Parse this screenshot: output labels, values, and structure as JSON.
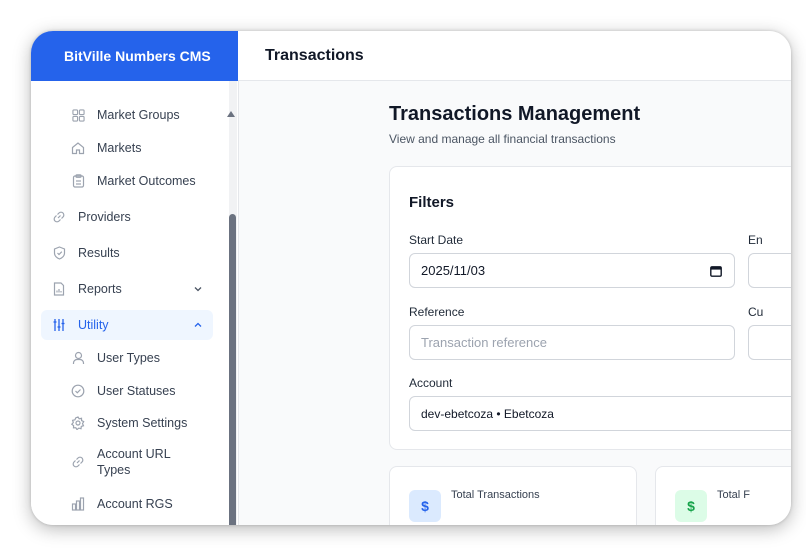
{
  "app": {
    "brand": "BitVille Numbers CMS",
    "header_title": "Transactions"
  },
  "sidebar": {
    "items": [
      {
        "label": "Market Groups"
      },
      {
        "label": "Markets"
      },
      {
        "label": "Market Outcomes"
      },
      {
        "label": "Providers"
      },
      {
        "label": "Results"
      },
      {
        "label": "Reports"
      },
      {
        "label": "Utility"
      },
      {
        "label": "User Types"
      },
      {
        "label": "User Statuses"
      },
      {
        "label": "System Settings"
      },
      {
        "label": "Account URL Types"
      },
      {
        "label": "Account RGS"
      }
    ],
    "accent_color": "#2563eb"
  },
  "page": {
    "title": "Transactions Management",
    "subtitle": "View and manage all financial transactions"
  },
  "filters": {
    "title": "Filters",
    "start_date": {
      "label": "Start Date",
      "value": "2025/11/03"
    },
    "end_date": {
      "label": "En"
    },
    "reference": {
      "label": "Reference",
      "placeholder": "Transaction reference"
    },
    "second_col_label": "Cu",
    "account": {
      "label": "Account",
      "value": "dev-ebetcoza • Ebetcoza"
    }
  },
  "stats": [
    {
      "label": "Total Transactions",
      "icon": "dollar-icon",
      "color": "#2563eb"
    },
    {
      "label": "Total F",
      "icon": "dollar-icon",
      "color": "#16a34a"
    }
  ]
}
